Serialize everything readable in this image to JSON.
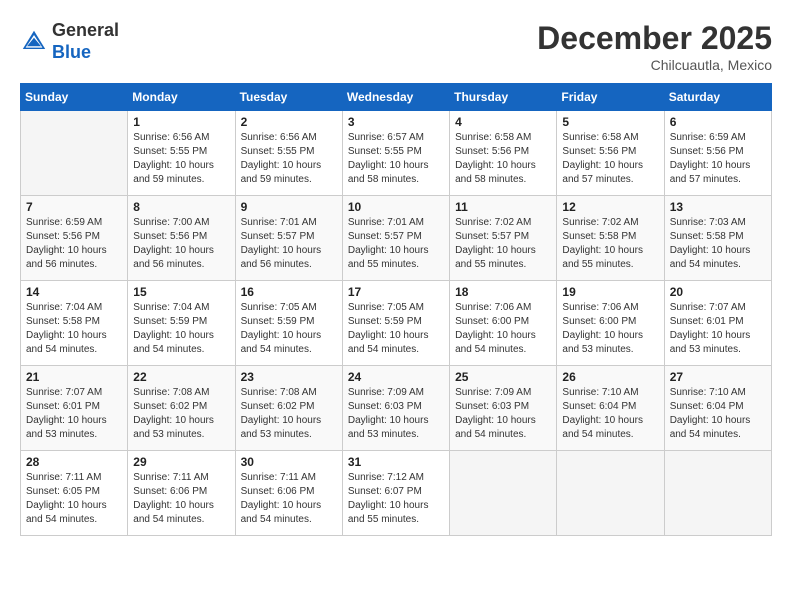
{
  "header": {
    "logo_line1": "General",
    "logo_line2": "Blue",
    "month": "December 2025",
    "location": "Chilcuautla, Mexico"
  },
  "weekdays": [
    "Sunday",
    "Monday",
    "Tuesday",
    "Wednesday",
    "Thursday",
    "Friday",
    "Saturday"
  ],
  "weeks": [
    [
      {
        "day": "",
        "info": ""
      },
      {
        "day": "1",
        "info": "Sunrise: 6:56 AM\nSunset: 5:55 PM\nDaylight: 10 hours\nand 59 minutes."
      },
      {
        "day": "2",
        "info": "Sunrise: 6:56 AM\nSunset: 5:55 PM\nDaylight: 10 hours\nand 59 minutes."
      },
      {
        "day": "3",
        "info": "Sunrise: 6:57 AM\nSunset: 5:55 PM\nDaylight: 10 hours\nand 58 minutes."
      },
      {
        "day": "4",
        "info": "Sunrise: 6:58 AM\nSunset: 5:56 PM\nDaylight: 10 hours\nand 58 minutes."
      },
      {
        "day": "5",
        "info": "Sunrise: 6:58 AM\nSunset: 5:56 PM\nDaylight: 10 hours\nand 57 minutes."
      },
      {
        "day": "6",
        "info": "Sunrise: 6:59 AM\nSunset: 5:56 PM\nDaylight: 10 hours\nand 57 minutes."
      }
    ],
    [
      {
        "day": "7",
        "info": "Sunrise: 6:59 AM\nSunset: 5:56 PM\nDaylight: 10 hours\nand 56 minutes."
      },
      {
        "day": "8",
        "info": "Sunrise: 7:00 AM\nSunset: 5:56 PM\nDaylight: 10 hours\nand 56 minutes."
      },
      {
        "day": "9",
        "info": "Sunrise: 7:01 AM\nSunset: 5:57 PM\nDaylight: 10 hours\nand 56 minutes."
      },
      {
        "day": "10",
        "info": "Sunrise: 7:01 AM\nSunset: 5:57 PM\nDaylight: 10 hours\nand 55 minutes."
      },
      {
        "day": "11",
        "info": "Sunrise: 7:02 AM\nSunset: 5:57 PM\nDaylight: 10 hours\nand 55 minutes."
      },
      {
        "day": "12",
        "info": "Sunrise: 7:02 AM\nSunset: 5:58 PM\nDaylight: 10 hours\nand 55 minutes."
      },
      {
        "day": "13",
        "info": "Sunrise: 7:03 AM\nSunset: 5:58 PM\nDaylight: 10 hours\nand 54 minutes."
      }
    ],
    [
      {
        "day": "14",
        "info": "Sunrise: 7:04 AM\nSunset: 5:58 PM\nDaylight: 10 hours\nand 54 minutes."
      },
      {
        "day": "15",
        "info": "Sunrise: 7:04 AM\nSunset: 5:59 PM\nDaylight: 10 hours\nand 54 minutes."
      },
      {
        "day": "16",
        "info": "Sunrise: 7:05 AM\nSunset: 5:59 PM\nDaylight: 10 hours\nand 54 minutes."
      },
      {
        "day": "17",
        "info": "Sunrise: 7:05 AM\nSunset: 5:59 PM\nDaylight: 10 hours\nand 54 minutes."
      },
      {
        "day": "18",
        "info": "Sunrise: 7:06 AM\nSunset: 6:00 PM\nDaylight: 10 hours\nand 54 minutes."
      },
      {
        "day": "19",
        "info": "Sunrise: 7:06 AM\nSunset: 6:00 PM\nDaylight: 10 hours\nand 53 minutes."
      },
      {
        "day": "20",
        "info": "Sunrise: 7:07 AM\nSunset: 6:01 PM\nDaylight: 10 hours\nand 53 minutes."
      }
    ],
    [
      {
        "day": "21",
        "info": "Sunrise: 7:07 AM\nSunset: 6:01 PM\nDaylight: 10 hours\nand 53 minutes."
      },
      {
        "day": "22",
        "info": "Sunrise: 7:08 AM\nSunset: 6:02 PM\nDaylight: 10 hours\nand 53 minutes."
      },
      {
        "day": "23",
        "info": "Sunrise: 7:08 AM\nSunset: 6:02 PM\nDaylight: 10 hours\nand 53 minutes."
      },
      {
        "day": "24",
        "info": "Sunrise: 7:09 AM\nSunset: 6:03 PM\nDaylight: 10 hours\nand 53 minutes."
      },
      {
        "day": "25",
        "info": "Sunrise: 7:09 AM\nSunset: 6:03 PM\nDaylight: 10 hours\nand 54 minutes."
      },
      {
        "day": "26",
        "info": "Sunrise: 7:10 AM\nSunset: 6:04 PM\nDaylight: 10 hours\nand 54 minutes."
      },
      {
        "day": "27",
        "info": "Sunrise: 7:10 AM\nSunset: 6:04 PM\nDaylight: 10 hours\nand 54 minutes."
      }
    ],
    [
      {
        "day": "28",
        "info": "Sunrise: 7:11 AM\nSunset: 6:05 PM\nDaylight: 10 hours\nand 54 minutes."
      },
      {
        "day": "29",
        "info": "Sunrise: 7:11 AM\nSunset: 6:06 PM\nDaylight: 10 hours\nand 54 minutes."
      },
      {
        "day": "30",
        "info": "Sunrise: 7:11 AM\nSunset: 6:06 PM\nDaylight: 10 hours\nand 54 minutes."
      },
      {
        "day": "31",
        "info": "Sunrise: 7:12 AM\nSunset: 6:07 PM\nDaylight: 10 hours\nand 55 minutes."
      },
      {
        "day": "",
        "info": ""
      },
      {
        "day": "",
        "info": ""
      },
      {
        "day": "",
        "info": ""
      }
    ]
  ]
}
